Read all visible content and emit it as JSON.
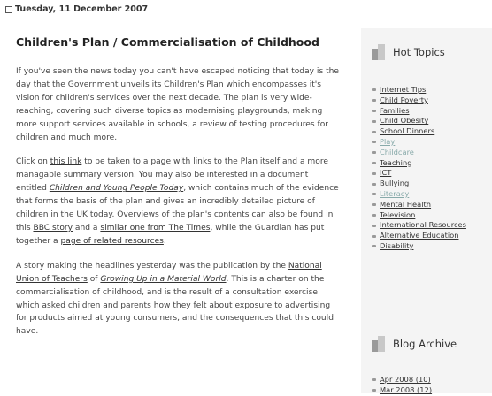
{
  "post": {
    "date": "Tuesday, 11 December 2007",
    "title": "Children's Plan / Commercialisation of Childhood",
    "p1": "If you've seen the news today you can't have escaped noticing that today is the day that the Government unveils its Children's Plan which encompasses it's vision for children's services over the next decade. The plan is very wide-reaching, covering such diverse topics as modernising playgrounds, making more support services available in schools, a review of testing procedures for children and much more.",
    "p2": {
      "t1": "Click on ",
      "link1": "this link",
      "t2": " to be taken to a page with links to the Plan itself and a more managable summary version. You may also be interested in a document entitled ",
      "link2": "Children and Young People Today",
      "t3": ", which contains much of the evidence that forms the basis of the plan and gives an incredibly detailed picture of children in the UK today. Overviews of the plan's contents can also be found in this ",
      "link3": "BBC story",
      "t4": " and a ",
      "link4": "similar one from The Times",
      "t5": ", while the Guardian has put together a ",
      "link5": "page of related resources",
      "t6": "."
    },
    "p3": {
      "t1": "A story making the headlines yesterday was the publication by the ",
      "link1": "National Union of Teachers",
      "t2": " of ",
      "link2": "Growing Up in a Material World",
      "t3": ". This is a charter on the commercialisation of childhood, and is the result of a consultation exercise which asked children and parents how they felt about exposure to advertising for products aimed at young consumers, and the consequences that this could have."
    }
  },
  "sidebar": {
    "hot_topics_title": "Hot Topics",
    "hot_topics": [
      "Internet Tips",
      "Child Poverty",
      "Families",
      "Child Obesity",
      "School Dinners",
      "Play",
      "Childcare",
      "Teaching",
      "ICT",
      "Bullying",
      "Literacy",
      "Mental Health",
      "Television",
      "International Resources",
      "Alternative Education",
      "Disability"
    ],
    "archive_title": "Blog Archive",
    "archive": [
      "Apr 2008 (10)",
      "Mar 2008 (12)"
    ]
  }
}
